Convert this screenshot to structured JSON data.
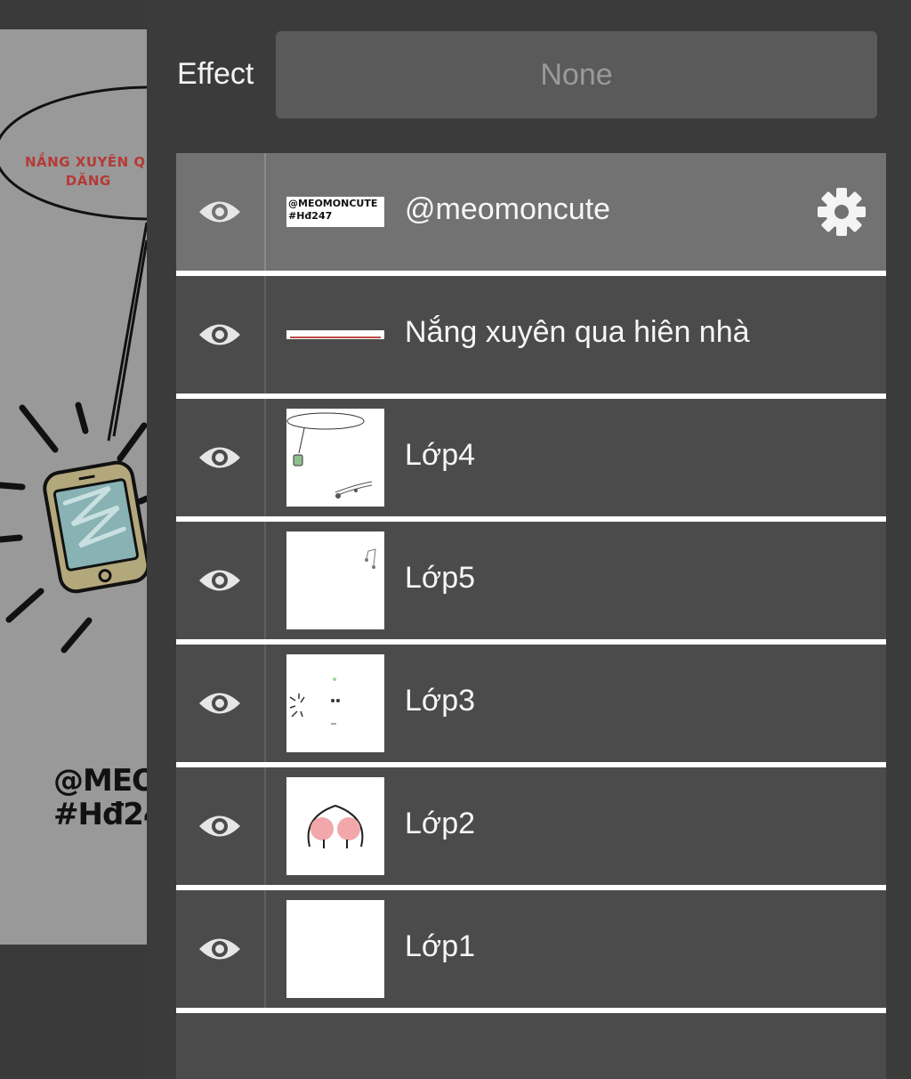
{
  "canvas": {
    "bubble_text": "NẮNG XUYÊN Q\n        DĂNG",
    "watermark_text": "@MEO\n#Hđ24"
  },
  "effect": {
    "label": "Effect",
    "value": "None"
  },
  "layers": [
    {
      "name": "@meomoncute",
      "selected": true,
      "visible": true,
      "thumb_text": "@MEOMONCUTE\n#Hđ247",
      "has_settings": true
    },
    {
      "name": "Nắng xuyên qua hiên nhà",
      "selected": false,
      "visible": true
    },
    {
      "name": "Lớp4",
      "selected": false,
      "visible": true
    },
    {
      "name": "Lớp5",
      "selected": false,
      "visible": true
    },
    {
      "name": "Lớp3",
      "selected": false,
      "visible": true
    },
    {
      "name": "Lớp2",
      "selected": false,
      "visible": true
    },
    {
      "name": "Lớp1",
      "selected": false,
      "visible": true
    }
  ],
  "icons": {
    "visibility": "eye-icon",
    "settings": "gear-icon"
  },
  "colors": {
    "panel_bg": "#3b3b3b",
    "row_bg": "#4b4b4b",
    "row_selected": "#727272",
    "separator": "#ffffff"
  }
}
